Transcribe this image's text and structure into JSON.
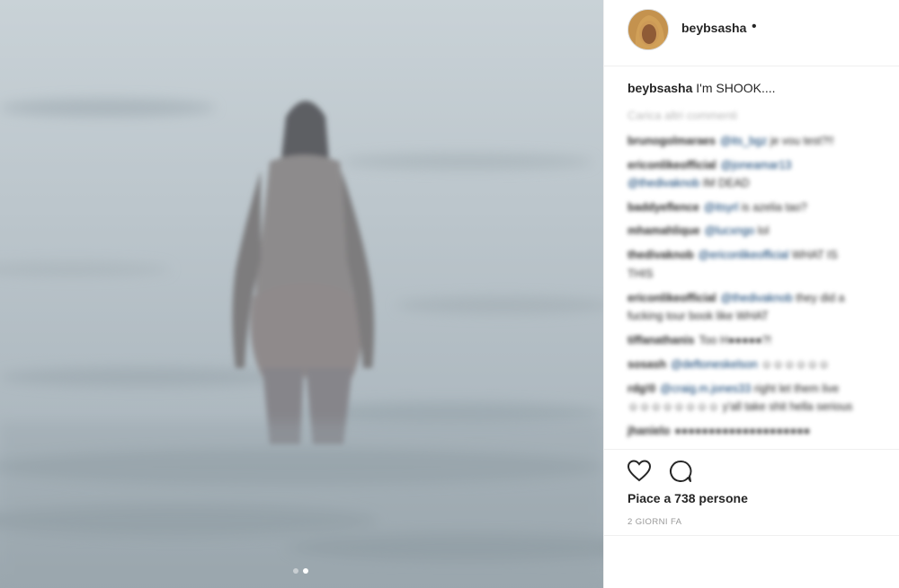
{
  "post": {
    "username": "beybsasha",
    "follow_dot": "•",
    "caption_user": "beybsasha",
    "caption_text": "I'm SHOOK....",
    "load_more": "Carica altri commenti",
    "media_alt": "photo of a person walking into the sea",
    "carousel": {
      "count": 2,
      "active": 2
    },
    "comments": [
      {
        "user": "brunogolmaraes",
        "mention": "@its_bgz",
        "text": "je vou test?!!"
      },
      {
        "user": "ericonlikeofficial",
        "mention": "@joneamar13",
        "text": ""
      },
      {
        "user": "",
        "mention": "@thedivaknob",
        "text": "IM DEAD"
      },
      {
        "user": "baddyeflence",
        "mention": "@itsyrl",
        "text": "is azelia tao?"
      },
      {
        "user": "mhamahlique",
        "mention": "@lucxngo",
        "text": "lol"
      },
      {
        "user": "thedivaknob",
        "mention": "@ericonlikeofficial",
        "text": "WHAT IS"
      },
      {
        "user": "",
        "mention": "",
        "text": "THIS"
      },
      {
        "user": "ericonlikeofficial",
        "mention": "@thedivaknob",
        "text": "they did a"
      },
      {
        "user": "",
        "mention": "",
        "text": "fucking tour book like WHAT"
      },
      {
        "user": "tiffanathanis",
        "mention": "",
        "text": "Too H●●●●●?!"
      },
      {
        "user": "sosash",
        "mention": "@deftoneskelson",
        "text": "☺☺☺☺☺☺"
      },
      {
        "user": "rdg!0",
        "mention": "@craig.m.jones33",
        "text": "right let them live"
      },
      {
        "user": "",
        "mention": "",
        "text": "☺☺☺☺☺☺☺☺ y'all take shit hella serious"
      },
      {
        "user": "jhanielo",
        "mention": "",
        "text": "●●●●●●●●●●●●●●●●●●●●"
      }
    ],
    "likes": "Piace a 738 persone",
    "time": "2 GIORNI FA"
  },
  "icons": {
    "like": "heart-icon",
    "comment": "comment-icon"
  },
  "colors": {
    "text": "#262626",
    "muted": "#999999",
    "mention": "#003569",
    "divider": "#efefef"
  }
}
